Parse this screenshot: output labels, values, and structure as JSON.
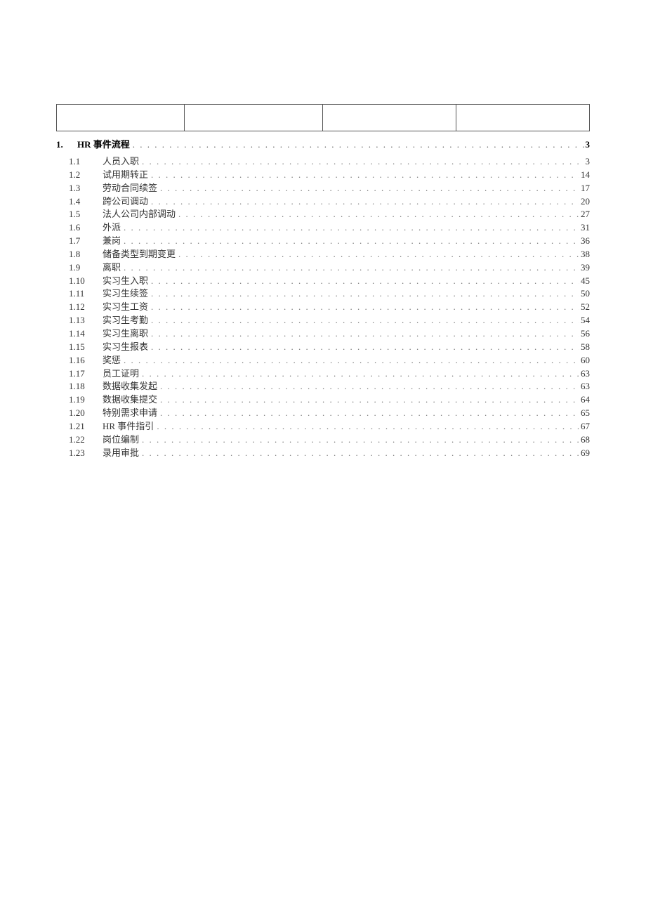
{
  "section": {
    "num": "1.",
    "title": "HR 事件流程",
    "page": "3"
  },
  "toc": [
    {
      "num": "1.1",
      "title": "人员入职",
      "page": "3"
    },
    {
      "num": "1.2",
      "title": "试用期转正",
      "page": "14"
    },
    {
      "num": "1.3",
      "title": "劳动合同续签",
      "page": "17"
    },
    {
      "num": "1.4",
      "title": "跨公司调动",
      "page": "20"
    },
    {
      "num": "1.5",
      "title": "法人公司内部调动",
      "page": "27"
    },
    {
      "num": "1.6",
      "title": "外派",
      "page": "31"
    },
    {
      "num": "1.7",
      "title": "兼岗",
      "page": "36"
    },
    {
      "num": "1.8",
      "title": "储备类型到期变更",
      "page": "38"
    },
    {
      "num": "1.9",
      "title": "离职",
      "page": "39"
    },
    {
      "num": "1.10",
      "title": "实习生入职",
      "page": "45"
    },
    {
      "num": "1.11",
      "title": "实习生续签",
      "page": "50"
    },
    {
      "num": "1.12",
      "title": "实习生工资",
      "page": "52"
    },
    {
      "num": "1.13",
      "title": "实习生考勤",
      "page": "54"
    },
    {
      "num": "1.14",
      "title": "实习生离职",
      "page": "56"
    },
    {
      "num": "1.15",
      "title": "实习生报表",
      "page": "58"
    },
    {
      "num": "1.16",
      "title": "奖惩",
      "page": "60"
    },
    {
      "num": "1.17",
      "title": "员工证明",
      "page": "63"
    },
    {
      "num": "1.18",
      "title": "数据收集发起",
      "page": "63"
    },
    {
      "num": "1.19",
      "title": "数据收集提交",
      "page": "64"
    },
    {
      "num": "1.20",
      "title": "特别需求申请",
      "page": "65"
    },
    {
      "num": "1.21",
      "title": "HR 事件指引",
      "page": "67"
    },
    {
      "num": "1.22",
      "title": "岗位编制",
      "page": "68"
    },
    {
      "num": "1.23",
      "title": "录用审批",
      "page": "69"
    }
  ]
}
